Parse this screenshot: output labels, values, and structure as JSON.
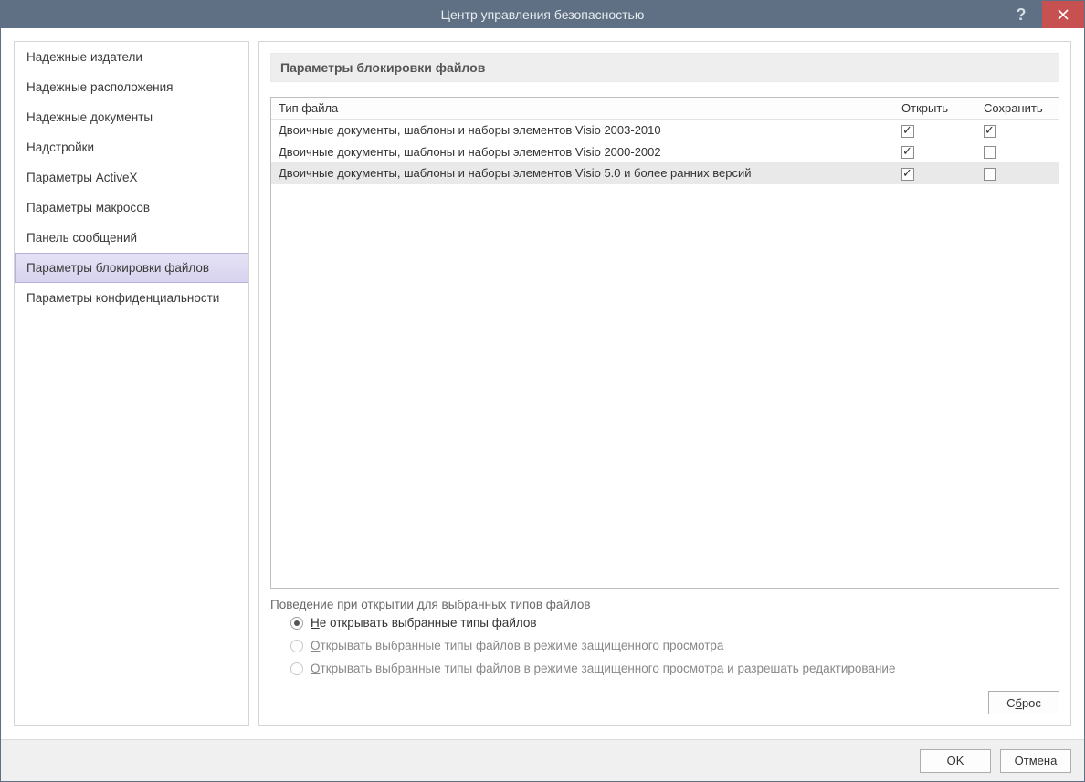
{
  "window": {
    "title": "Центр управления безопасностью"
  },
  "sidebar": {
    "items": [
      {
        "label": "Надежные издатели"
      },
      {
        "label": "Надежные расположения"
      },
      {
        "label": "Надежные документы"
      },
      {
        "label": "Надстройки"
      },
      {
        "label": "Параметры ActiveX"
      },
      {
        "label": "Параметры макросов"
      },
      {
        "label": "Панель сообщений"
      },
      {
        "label": "Параметры блокировки файлов",
        "selected": true
      },
      {
        "label": "Параметры конфиденциальности"
      }
    ]
  },
  "panel": {
    "heading": "Параметры блокировки файлов",
    "columns": {
      "type": "Тип файла",
      "open": "Открыть",
      "save": "Сохранить"
    },
    "rows": [
      {
        "type": "Двоичные документы, шаблоны и наборы элементов Visio 2003-2010",
        "open": true,
        "save": true
      },
      {
        "type": "Двоичные документы, шаблоны и наборы элементов Visio 2000-2002",
        "open": true,
        "save": false
      },
      {
        "type": "Двоичные документы, шаблоны и наборы элементов Visio 5.0 и более ранних версий",
        "open": true,
        "save": false,
        "selected": true
      }
    ],
    "behavior_label": "Поведение при открытии для выбранных типов файлов",
    "radios": [
      {
        "pre": "Н",
        "rest": "е открывать выбранные типы файлов",
        "checked": true,
        "enabled": true
      },
      {
        "pre": "О",
        "rest": "ткрывать выбранные типы файлов в режиме защищенного просмотра",
        "checked": false,
        "enabled": false
      },
      {
        "pre": "О",
        "rest": "ткрывать выбранные типы файлов в режиме защищенного просмотра и разрешать редактирование",
        "checked": false,
        "enabled": false
      }
    ],
    "reset_pre": "С",
    "reset_u": "б",
    "reset_post": "рос"
  },
  "buttons": {
    "ok": "OK",
    "cancel": "Отмена"
  }
}
